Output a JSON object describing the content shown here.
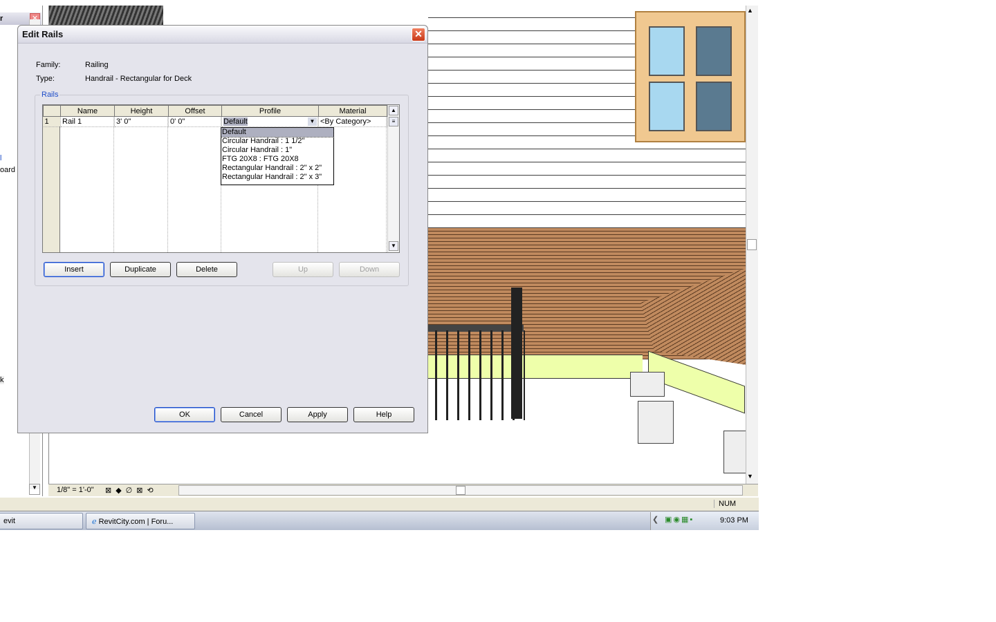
{
  "left_panel": {
    "title_fragment": "r",
    "items": [
      "l",
      "oard",
      "k"
    ]
  },
  "view": {
    "scale": "1/8\" = 1'-0\""
  },
  "status": {
    "num": "NUM"
  },
  "taskbar": {
    "tasks": [
      "evit",
      "RevitCity.com | Foru..."
    ],
    "clock": "9:03 PM"
  },
  "dialog": {
    "title": "Edit Rails",
    "family_label": "Family:",
    "family_value": "Railing",
    "type_label": "Type:",
    "type_value": "Handrail - Rectangular for Deck",
    "group_label": "Rails",
    "columns": [
      "Name",
      "Height",
      "Offset",
      "Profile",
      "Material"
    ],
    "rows": [
      {
        "num": "1",
        "name": "Rail 1",
        "height": "3'  0\"",
        "offset": "0'  0\"",
        "profile": "Default",
        "material": "<By Category>"
      }
    ],
    "profile_options": [
      "Default",
      "Circular Handrail : 1 1/2\"",
      "Circular Handrail : 1\"",
      "FTG 20X8 : FTG 20X8",
      "Rectangular Handrail : 2\" x 2\"",
      "Rectangular Handrail : 2\" x 3\""
    ],
    "buttons": {
      "insert": "Insert",
      "duplicate": "Duplicate",
      "delete": "Delete",
      "up": "Up",
      "down": "Down",
      "ok": "OK",
      "cancel": "Cancel",
      "apply": "Apply",
      "help": "Help"
    }
  }
}
